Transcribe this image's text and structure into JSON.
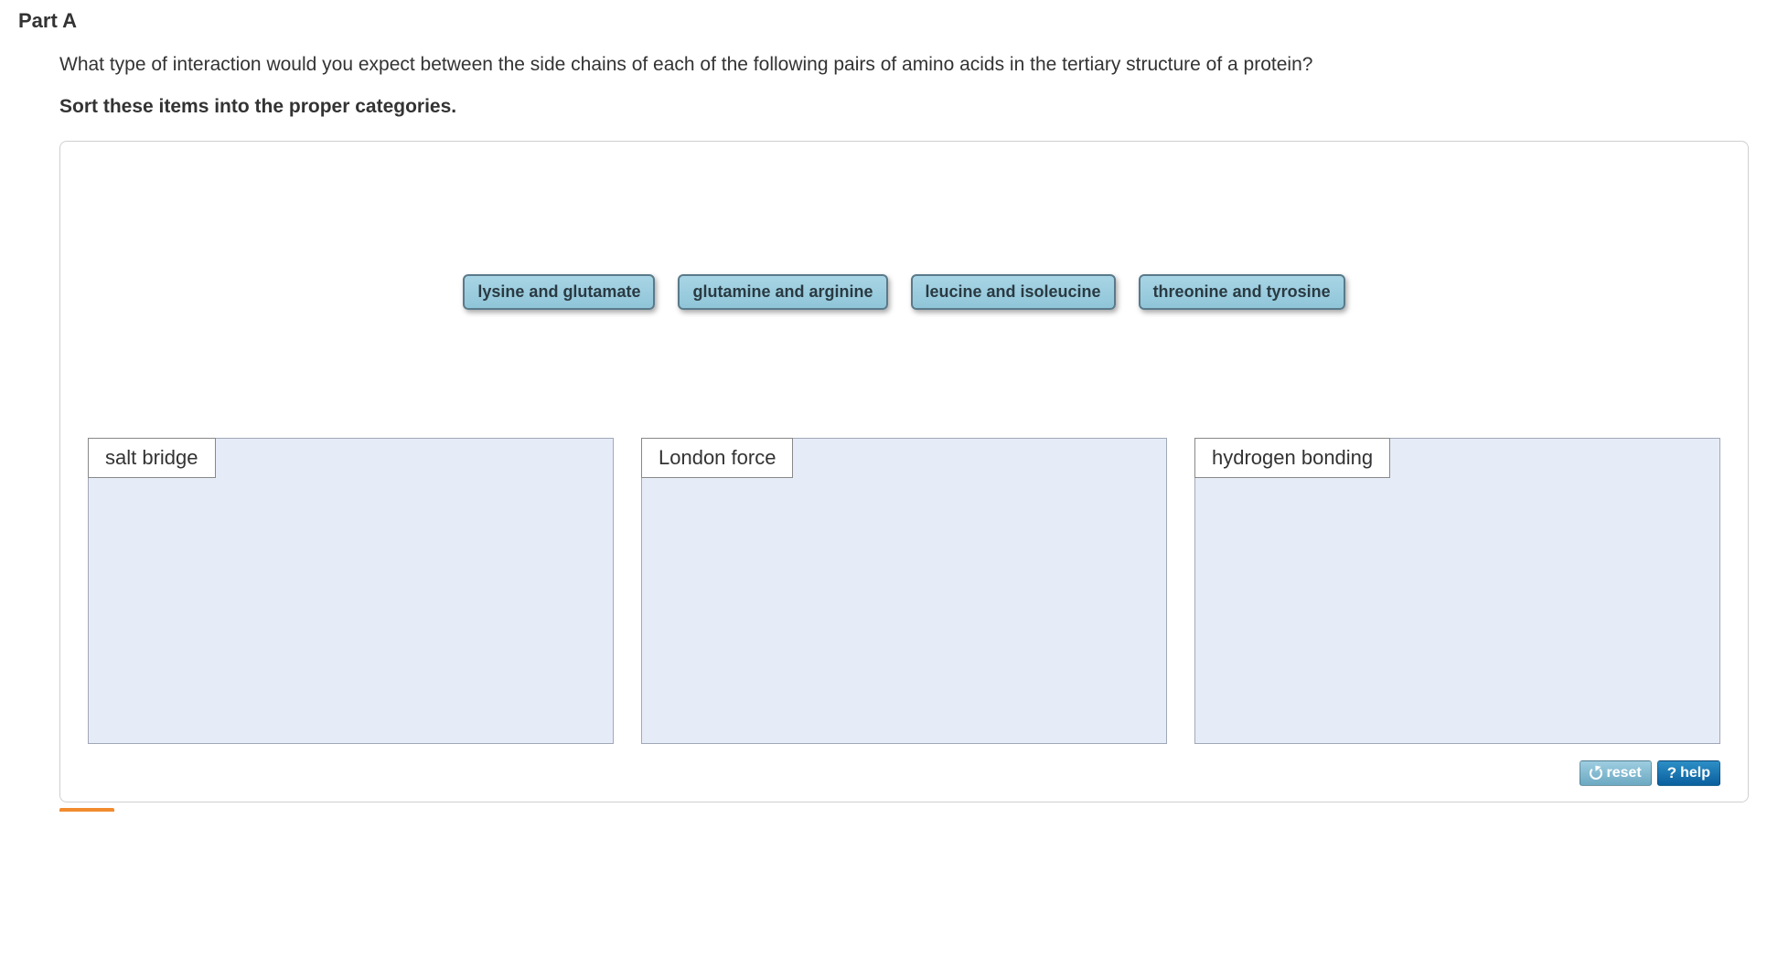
{
  "part": {
    "header": "Part A",
    "question": "What type of interaction would you expect between the side chains of each of the following pairs of amino acids in the tertiary structure of a protein?",
    "instruction": "Sort these items into the proper categories."
  },
  "items": [
    {
      "label": "lysine and glutamate"
    },
    {
      "label": "glutamine and arginine"
    },
    {
      "label": "leucine and isoleucine"
    },
    {
      "label": "threonine and tyrosine"
    }
  ],
  "categories": [
    {
      "label": "salt bridge"
    },
    {
      "label": "London force"
    },
    {
      "label": "hydrogen bonding"
    }
  ],
  "buttons": {
    "reset": "reset",
    "help": "help"
  }
}
